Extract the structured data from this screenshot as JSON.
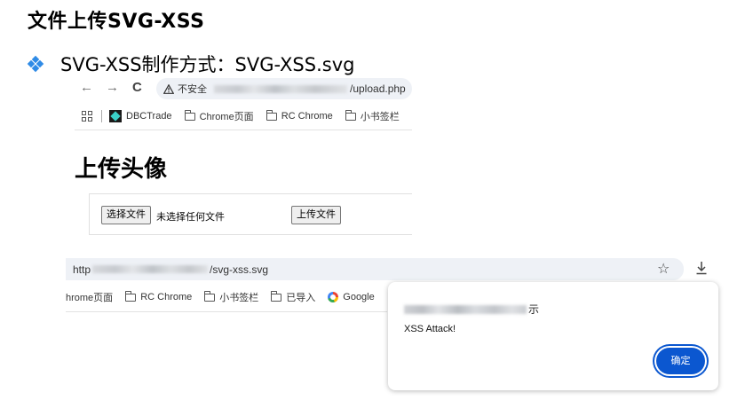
{
  "slide": {
    "title": "文件上传SVG-XSS",
    "bullet": "SVG-XSS制作方式：SVG-XSS.svg"
  },
  "shot1": {
    "nav": {
      "back": "←",
      "forward": "→",
      "reload": "C"
    },
    "address": {
      "security_label": "不安全",
      "url_tail": "/upload.php"
    },
    "bookmarks": [
      "DBCTrade",
      "Chrome页面",
      "RC Chrome",
      "小书签栏"
    ],
    "page_heading": "上传头像",
    "form": {
      "choose_button": "选择文件",
      "no_file_text": "未选择任何文件",
      "upload_button": "上传文件"
    }
  },
  "shot2": {
    "address": {
      "url_head": "http",
      "url_tail": "/svg-xss.svg"
    },
    "star": "☆",
    "bookmarks": [
      "hrome页面",
      "RC Chrome",
      "小书签栏",
      "已导入",
      "Google"
    ],
    "dialog": {
      "title_suffix": "示",
      "message": "XSS Attack!",
      "ok_label": "确定"
    }
  },
  "colors": {
    "accent": "#0b57d0",
    "bullet": "#2f8be6"
  }
}
